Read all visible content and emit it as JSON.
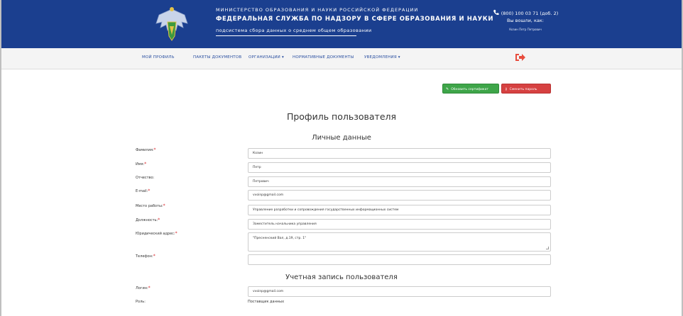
{
  "header": {
    "ministry": "МИНИСТЕРСТВО ОБРАЗОВАНИЯ И НАУКИ РОССИЙСКОЙ ФЕДЕРАЦИИ",
    "service": "ФЕДЕРАЛЬНАЯ СЛУЖБА ПО НАДЗОРУ В СФЕРЕ ОБРАЗОВАНИЯ И НАУКИ",
    "subsystem": "подсистема сбора данных о среднем общем образовании",
    "phone": "(800) 100 03 71 (доб. 2)",
    "logged_in_label": "Вы вошли, как:",
    "user": "Козин Петр Петрович",
    "brand_color": "#1b3f8f"
  },
  "nav": {
    "items": [
      {
        "label": "МОЙ ПРОФИЛЬ"
      },
      {
        "label": "ПАКЕТЫ ДОКУМЕНТОВ"
      },
      {
        "label": "ОРГАНИЗАЦИИ ▾"
      },
      {
        "label": "НОРМАТИВНЫЕ ДОКУМЕНТЫ"
      },
      {
        "label": "УВЕДОМЛЕНИЯ ▾"
      }
    ],
    "logout_icon": "sign-out-icon",
    "logout_color": "#e84c3d"
  },
  "actions": {
    "update_cert": "Обновить сертификат",
    "change_password": "Сменить пароль",
    "update_cert_icon": "pencil-icon",
    "change_password_icon": "key-icon"
  },
  "page": {
    "title": "Профиль пользователя",
    "personal_section": "Личные данные",
    "account_section": "Учетная запись пользователя"
  },
  "personal": {
    "surname": {
      "label": "Фамилия:",
      "value": "Козин",
      "required": "*"
    },
    "name": {
      "label": "Имя:",
      "value": "Петр",
      "required": "*"
    },
    "patronymic": {
      "label": "Отчество:",
      "value": "Петрович"
    },
    "email": {
      "label": "E-mail:",
      "value": "vvoinp@gmail.com",
      "required": "*"
    },
    "workplace": {
      "label": "Место работы:",
      "value": "Управление разработки и сопровождения государственных информационных систем",
      "required": "*"
    },
    "position": {
      "label": "Должность:",
      "value": "Заместитель начальника управления",
      "required": "*"
    },
    "legal_address": {
      "label": "Юридический адрес:",
      "value": "\"Пресненский Вал, д.19, стр. 1\"",
      "required": "*"
    },
    "phone": {
      "label": "Телефон:",
      "value": "",
      "required": "*"
    }
  },
  "account": {
    "login": {
      "label": "Логин:",
      "value": "vvoinp@gmail.com",
      "required": "*"
    },
    "roles": {
      "label": "Роль:",
      "value": "Поставщик данных"
    }
  }
}
